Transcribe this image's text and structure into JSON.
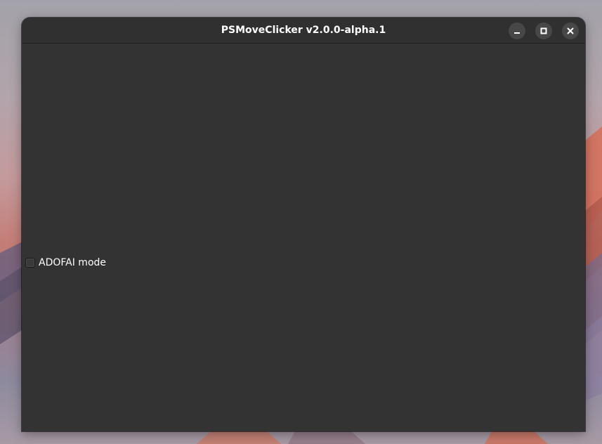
{
  "window": {
    "title": "PSMoveClicker v2.0.0-alpha.1",
    "controls": {
      "minimize": "minimize-icon",
      "maximize": "maximize-icon",
      "close": "close-icon"
    }
  },
  "content": {
    "adofai_mode": {
      "label": "ADOFAI mode",
      "checked": false
    }
  },
  "colors": {
    "window_bg": "#333333",
    "titlebar_bg": "#303030",
    "control_bg": "#474747",
    "text": "#ffffff"
  }
}
